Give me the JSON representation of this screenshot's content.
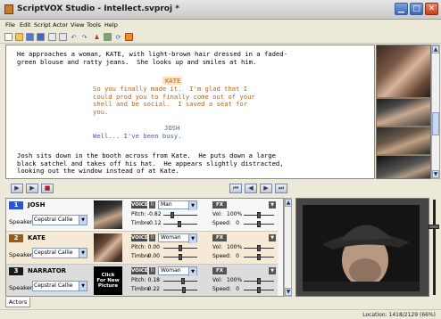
{
  "window": {
    "title": "ScriptVOX Studio - Intellect.svproj *"
  },
  "menu": [
    "File",
    "Edit",
    "Script",
    "Actor",
    "View",
    "Tools",
    "Help"
  ],
  "toolbar_icons": [
    "new-icon",
    "open-icon",
    "save-icon",
    "save-all-icon",
    "properties-icon",
    "copy-icon",
    "undo-icon",
    "redo-icon",
    "actor-icon",
    "image-icon",
    "refresh-icon",
    "voice-icon"
  ],
  "script": {
    "para1": "He approaches a woman, KATE, with light-brown hair dressed in a faded-\ngreen blouse and ratty jeans.  She looks up and smiles at him.",
    "kate_name": "KATE",
    "kate_line": "So you finally made it.  I'm glad that I\ncould prod you to finally come out of your\nshell and be social.  I saved a seat for\nyou.",
    "josh_name": "JOSH",
    "josh_line": "Well... I've been busy.",
    "para2": "Josh sits down in the booth across from Kate.  He puts down a large\nblack satchel and takes off his hat.  He appears slightly distracted,\nlooking out the window instead of at Kate."
  },
  "actors": [
    {
      "num": "1",
      "name": "JOSH",
      "num_color": "#2d57c8",
      "row_color": "#f7f7f7",
      "speaker_label": "Speaker:",
      "speaker": "Cepstral Callie",
      "voice": "Man",
      "pitch": "-0.82",
      "timbre": "-0.12",
      "vol": "100%",
      "speed": "0"
    },
    {
      "num": "2",
      "name": "KATE",
      "num_color": "#9a5a1c",
      "row_color": "#f6ead6",
      "speaker_label": "Speaker:",
      "speaker": "Cepstral Callie",
      "voice": "Woman",
      "pitch": "0.00",
      "timbre": "0.00",
      "vol": "100%",
      "speed": "0"
    },
    {
      "num": "3",
      "name": "NARRATOR",
      "num_color": "#1a1a1a",
      "row_color": "#dcdcdc",
      "speaker_label": "Speaker:",
      "speaker": "Cepstral Callie",
      "voice": "Woman",
      "pitch": "0.18",
      "timbre": "0.22",
      "vol": "100%",
      "speed": "0",
      "picture_text": "Click\nFor New\nPicture"
    }
  ],
  "labels": {
    "voice": "VOICE",
    "ii": "ĪI",
    "fx": "FX",
    "pitch": "Pitch:",
    "timbre": "Timbre",
    "vol": "Vol:",
    "speed": "Speed:"
  },
  "bottom": {
    "actors_tab": "Actors",
    "location": "Location: 1418/2129 (66%)"
  }
}
